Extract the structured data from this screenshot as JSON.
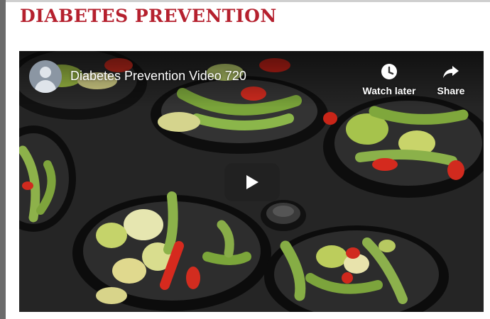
{
  "page": {
    "title": "DIABETES PREVENTION"
  },
  "video": {
    "title": "Diabetes Prevention Video 720",
    "watch_later_label": "Watch later",
    "share_label": "Share",
    "icons": {
      "channel": "channel-avatar-icon",
      "watch_later": "clock-icon",
      "share": "share-arrow-icon",
      "play": "play-icon"
    }
  },
  "colors": {
    "title": "#b5202e",
    "player_overlay": "#212121"
  }
}
